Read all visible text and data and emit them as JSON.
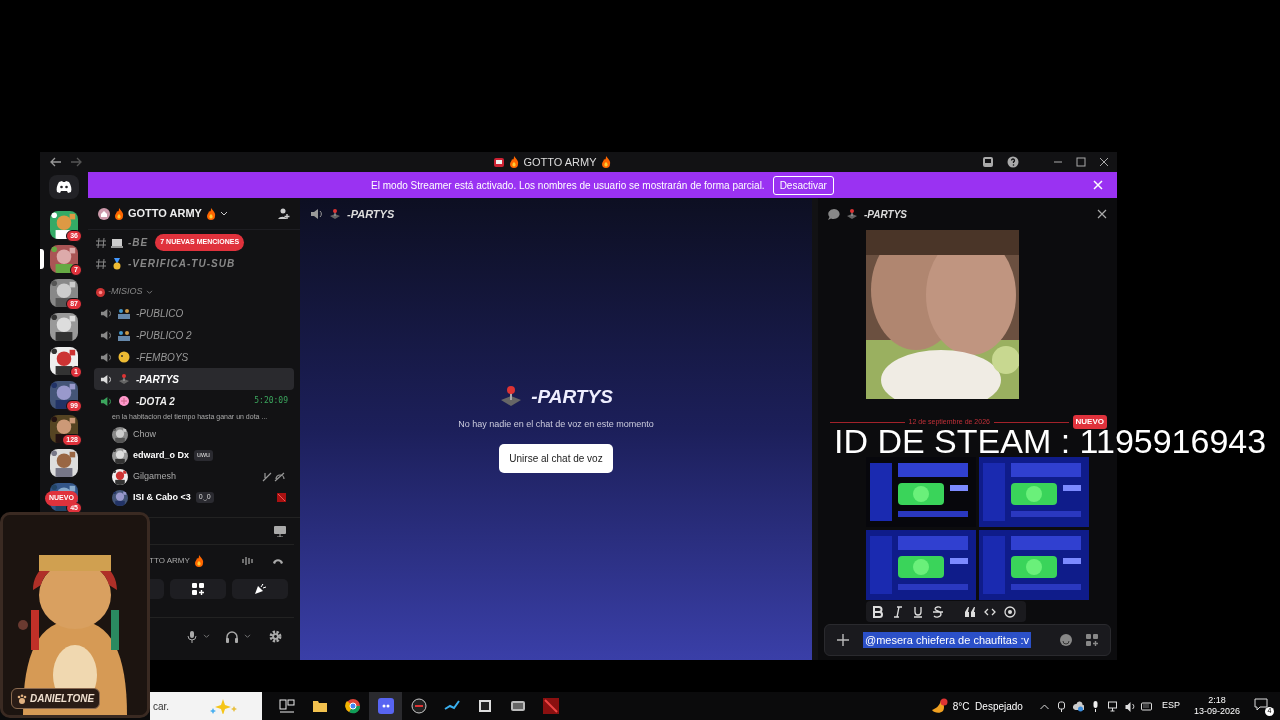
{
  "window": {
    "title": "GOTTO ARMY"
  },
  "streamer_banner": {
    "text": "El modo Streamer está activado. Los nombres de usuario se mostrarán de forma parcial.",
    "button": "Desactivar"
  },
  "servers": [
    {
      "badge": "36",
      "selected": false
    },
    {
      "badge": "7",
      "selected": true
    },
    {
      "badge": "87",
      "selected": false
    },
    {
      "selected": false
    },
    {
      "badge": "1",
      "selected": false
    },
    {
      "badge": "99",
      "selected": false
    },
    {
      "badge": "128",
      "selected": false
    },
    {
      "selected": false
    },
    {
      "badge": "45",
      "selected": false
    }
  ],
  "servers_new_badge": "NUEVO",
  "server": {
    "name": "GOTTO ARMY"
  },
  "mentions_badge": "7 NUEVAS MENCIONES",
  "text_channels": [
    {
      "name": "-BE"
    },
    {
      "name": "-VERIFICA-TU-SUB"
    }
  ],
  "category": {
    "name": "-MISIOS"
  },
  "voice_channels": [
    {
      "name": "-PUBLICO",
      "selected": false
    },
    {
      "name": "-PUBLICO 2",
      "selected": false
    },
    {
      "name": "-FEMBOYS",
      "selected": false
    },
    {
      "name": "-PARTYS",
      "selected": true
    },
    {
      "name": "-DOTA 2",
      "selected": false,
      "timer": "5:20:09",
      "status": "en la habitacion del tiempo hasta ganar un dota ...",
      "members": [
        {
          "name": "Chow",
          "muted": false
        },
        {
          "name": "edward_o Dx",
          "tag": "uwu",
          "muted": false
        },
        {
          "name": "Gilgamesh",
          "muted": true
        },
        {
          "name": "ISI & Cabo <3",
          "tag": "0‿0",
          "muted": false
        }
      ]
    }
  ],
  "voice_panel": {
    "server": "TTO ARMY"
  },
  "voice_view": {
    "channel": "-PARTYS",
    "title": "-PARTYS",
    "empty_text": "No hay nadie en el chat de voz en este momento",
    "join_button": "Unirse al chat de voz"
  },
  "chat": {
    "channel": "-PARTYS",
    "date_divider": "12 de septiembre de 2026",
    "new_badge": "NUEVO",
    "input_value": "@mesera chiefera de chaufitas :v"
  },
  "overlay": {
    "steam_id": "ID DE STEAM : 1195916943",
    "streamer": "DANIELTONE"
  },
  "taskbar": {
    "search": "car.",
    "weather": "8°C  Despejado",
    "language": "ESP",
    "time": "2:18",
    "date": "13-09-2026",
    "notifications": "4"
  }
}
